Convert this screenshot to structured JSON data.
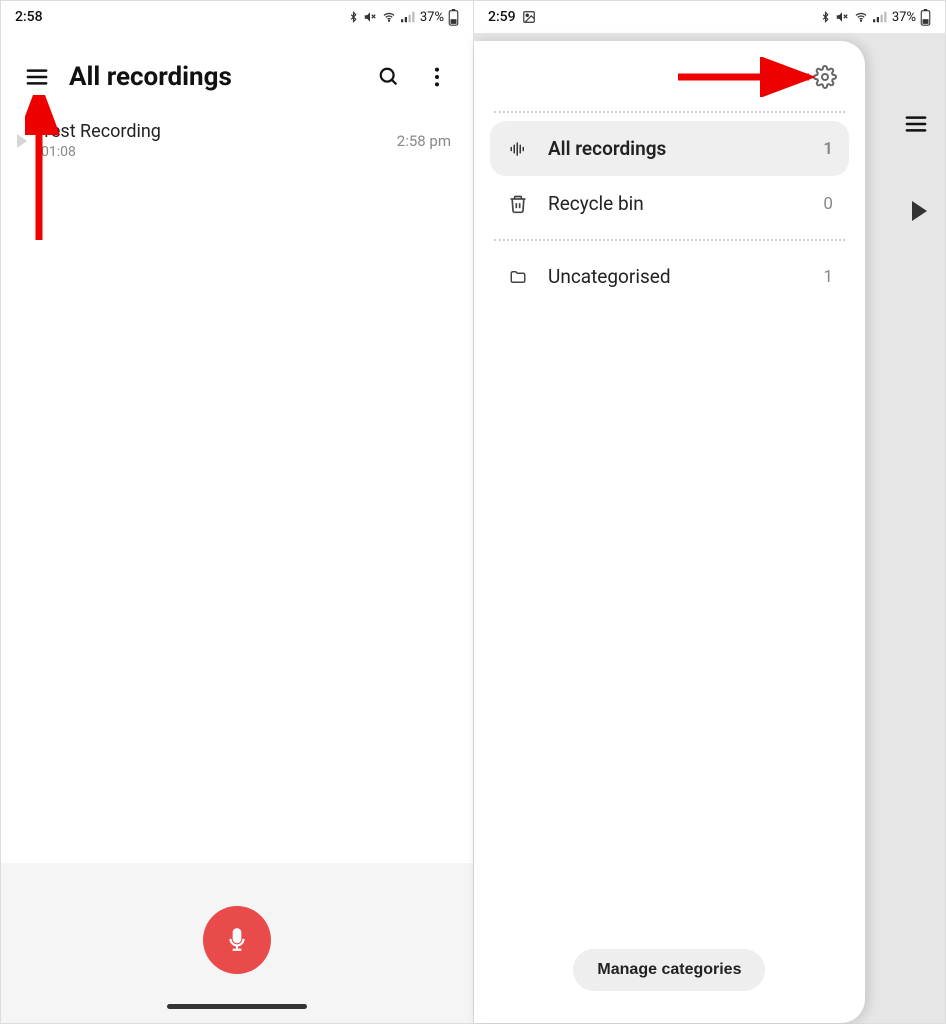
{
  "left": {
    "status": {
      "time": "2:58",
      "battery": "37%"
    },
    "header": {
      "title": "All recordings"
    },
    "recordings": [
      {
        "title": "Test Recording",
        "duration": "01:08",
        "time": "2:58 pm"
      }
    ]
  },
  "right": {
    "status": {
      "time": "2:59",
      "battery": "37%"
    },
    "drawer": {
      "items_top": [
        {
          "icon": "waveform",
          "label": "All recordings",
          "count": "1",
          "selected": true
        },
        {
          "icon": "trash",
          "label": "Recycle bin",
          "count": "0",
          "selected": false
        }
      ],
      "items_bottom": [
        {
          "icon": "folder",
          "label": "Uncategorised",
          "count": "1"
        }
      ],
      "manage_label": "Manage categories"
    }
  }
}
